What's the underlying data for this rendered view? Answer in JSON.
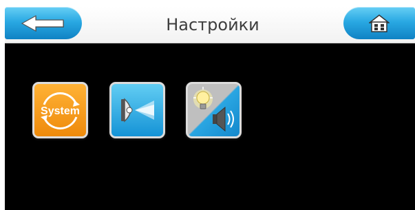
{
  "header": {
    "title": "Настройки"
  },
  "icons": {
    "back": "back-arrow-icon",
    "home": "home-icon",
    "system": "system-settings-icon",
    "lights": "headlight-icon",
    "light_sound": "light-and-sound-icon"
  },
  "tiles": {
    "system_label": "System"
  },
  "colors": {
    "header_button": "#2aa9e3",
    "background": "#000000",
    "system_tile": "#ee8a0b",
    "lights_tile": "#1593d6"
  }
}
